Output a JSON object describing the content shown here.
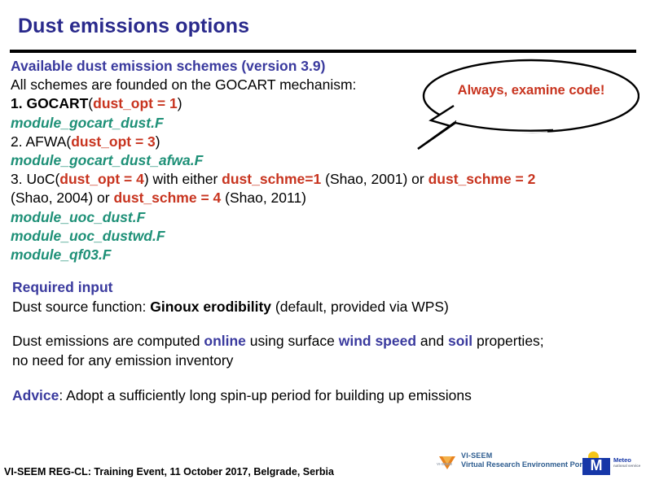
{
  "slide": {
    "title": "Dust emissions options"
  },
  "schemes": {
    "heading": "Available dust emission schemes (version 3.9)",
    "intro": "All schemes are founded on the GOCART mechanism:",
    "item1_num": "1. GOCART",
    "item1_paren_open": "(",
    "item1_opt": "dust_opt = 1",
    "item1_paren_close": ")",
    "item1_module": "module_gocart_dust.F",
    "item2_num": "2. AFWA",
    "item2_paren_open": "(",
    "item2_opt": "dust_opt = 3",
    "item2_paren_close": ")",
    "item2_module": "module_gocart_dust_afwa.F",
    "item3_num": "3. UoC",
    "item3_paren_open": "(",
    "item3_opt": "dust_opt = 4",
    "item3_paren_close": ")",
    "item3_mid": " with either ",
    "item3_schme1": "dust_schme=1",
    "item3_ref1": " (Shao, 2001) or ",
    "item3_schme2": "dust_schme = 2",
    "item3_ref2": "(Shao, 2004) or ",
    "item3_schme4": "dust_schme = 4",
    "item3_ref3": " (Shao, 2011)",
    "item3_module_a": "module_uoc_dust.F",
    "item3_module_b": "module_uoc_dustwd.F",
    "item3_module_c": "module_qf03.F"
  },
  "balloon": {
    "text": "Always, examine code!"
  },
  "required": {
    "heading": "Required input",
    "line_prefix": "Dust source function: ",
    "line_bold": "Ginoux erodibility",
    "line_suffix": " (default, provided via WPS)"
  },
  "online": {
    "part1": "Dust emissions are computed ",
    "em1": "online",
    "part2": " using surface ",
    "em2": "wind speed",
    "part3": " and ",
    "em3": "soil",
    "part4": " properties;",
    "line2": "no need for any emission inventory"
  },
  "advice": {
    "label": "Advice",
    "text": ": Adopt a sufficiently long spin-up period for building up emissions"
  },
  "footer": {
    "text": "VI-SEEM REG-CL: Training Event, 11 October 2017, Belgrade, Serbia",
    "viseem_name": "VI-SEEM",
    "viseem_sub": "Virtual Research Environment Portal",
    "viseem_tiny": "VI-SEEM",
    "meteo_name": "Meteo",
    "meteo_sub": "national\nservice",
    "meteo_letter": "M"
  },
  "colors": {
    "title": "#2A2A8C",
    "heading": "#3A3A9E",
    "accent_red": "#C8341F",
    "accent_green": "#1E9077",
    "rule": "#000000",
    "meteo_blue": "#1637A8",
    "meteo_yellow": "#F5C518",
    "viseem_blue": "#2D5C8F"
  }
}
